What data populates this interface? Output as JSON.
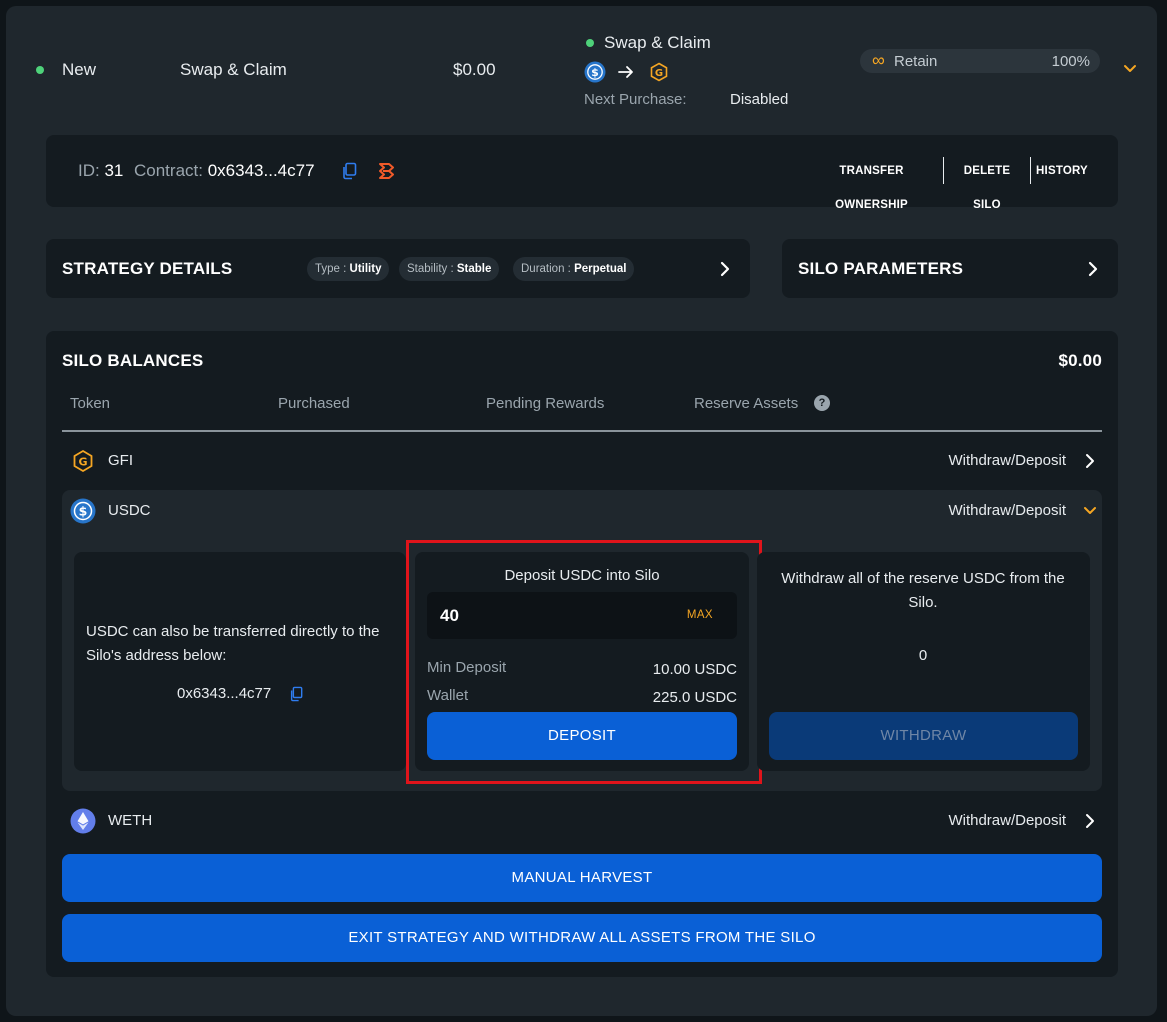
{
  "summary": {
    "status": "New",
    "strategy_name": "Swap & Claim",
    "value": "$0.00",
    "action_title": "Swap & Claim",
    "next_purchase_label": "Next Purchase:",
    "next_purchase_value": "Disabled",
    "retain_label": "Retain",
    "retain_percent": "100%",
    "status_color": "#4ed27a"
  },
  "info": {
    "id_label": "ID:",
    "id_value": "31",
    "contract_label": "Contract:",
    "contract_value": "0x6343...4c77",
    "actions": [
      "TRANSFER OWNERSHIP",
      "DELETE SILO",
      "HISTORY"
    ]
  },
  "strategy": {
    "title": "STRATEGY DETAILS",
    "badges": [
      {
        "label": "Type :",
        "value": "Utility"
      },
      {
        "label": "Stability :",
        "value": "Stable"
      },
      {
        "label": "Duration :",
        "value": "Perpetual"
      }
    ]
  },
  "parameters": {
    "title": "SILO PARAMETERS"
  },
  "balances": {
    "title": "SILO BALANCES",
    "total": "$0.00",
    "columns": [
      "Token",
      "Purchased",
      "Pending Rewards",
      "Reserve Assets"
    ],
    "help_glyph": "?",
    "tokens": [
      {
        "symbol": "GFI",
        "action": "Withdraw/Deposit",
        "icon": "gfi-token-icon"
      },
      {
        "symbol": "USDC",
        "action": "Withdraw/Deposit",
        "icon": "usdc-token-icon"
      },
      {
        "symbol": "WETH",
        "action": "Withdraw/Deposit",
        "icon": "weth-token-icon"
      }
    ]
  },
  "usdc_panel": {
    "transfer_note": "USDC can also be transferred directly to the Silo's address below:",
    "address": "0x6343...4c77",
    "deposit_title": "Deposit USDC into Silo",
    "deposit_amount": "40",
    "max_label": "MAX",
    "min_deposit_label": "Min Deposit",
    "min_deposit_value": "10.00 USDC",
    "wallet_label": "Wallet",
    "wallet_value": "225.0 USDC",
    "deposit_button": "DEPOSIT",
    "withdraw_title": "Withdraw all of the reserve USDC from the Silo.",
    "withdraw_amount": "0",
    "withdraw_button": "WITHDRAW"
  },
  "footer_buttons": {
    "harvest": "MANUAL HARVEST",
    "exit": "EXIT STRATEGY AND WITHDRAW ALL ASSETS FROM THE SILO"
  },
  "colors": {
    "accent_blue": "#0a60d6",
    "highlight_red": "#e0141b",
    "gfi_orange": "#f5a623",
    "usdc_blue": "#2775ca"
  }
}
